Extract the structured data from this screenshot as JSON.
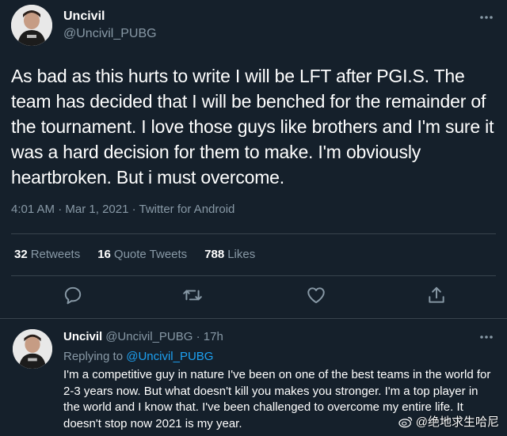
{
  "tweet": {
    "display_name": "Uncivil",
    "handle": "@Uncivil_PUBG",
    "text": "As bad as this hurts to write I will be LFT after PGI.S. The team has decided that I will be benched for the remainder of the tournament. I love those guys like brothers and I'm sure it was a hard decision for them to make. I'm obviously heartbroken. But i must overcome.",
    "time": "4:01 AM",
    "date": "Mar 1, 2021",
    "source": "Twitter for Android",
    "sep": " · ",
    "retweets_count": "32",
    "retweets_label": "Retweets",
    "quotes_count": "16",
    "quotes_label": "Quote Tweets",
    "likes_count": "788",
    "likes_label": "Likes"
  },
  "reply": {
    "display_name": "Uncivil",
    "handle": "@Uncivil_PUBG",
    "dot": " · ",
    "age": "17h",
    "replying_label": "Replying to ",
    "replying_to": "@Uncivil_PUBG",
    "text": "I'm a competitive guy in nature I've been on one of the best teams in the world for 2-3 years now. But what doesn't kill you makes you stronger. I'm a top player in the world and I know that. I've been challenged to overcome my entire life. It doesn't stop now 2021 is my year."
  },
  "watermark": {
    "text": "@绝地求生哈尼"
  },
  "icons": {
    "more": "more-horizontal-icon",
    "reply": "reply-icon",
    "retweet": "retweet-icon",
    "like": "heart-icon",
    "share": "share-icon",
    "weibo": "weibo-icon"
  },
  "colors": {
    "background": "#15202b",
    "secondary_text": "#8899a6",
    "link": "#1da1f2",
    "divider": "#38444d"
  }
}
